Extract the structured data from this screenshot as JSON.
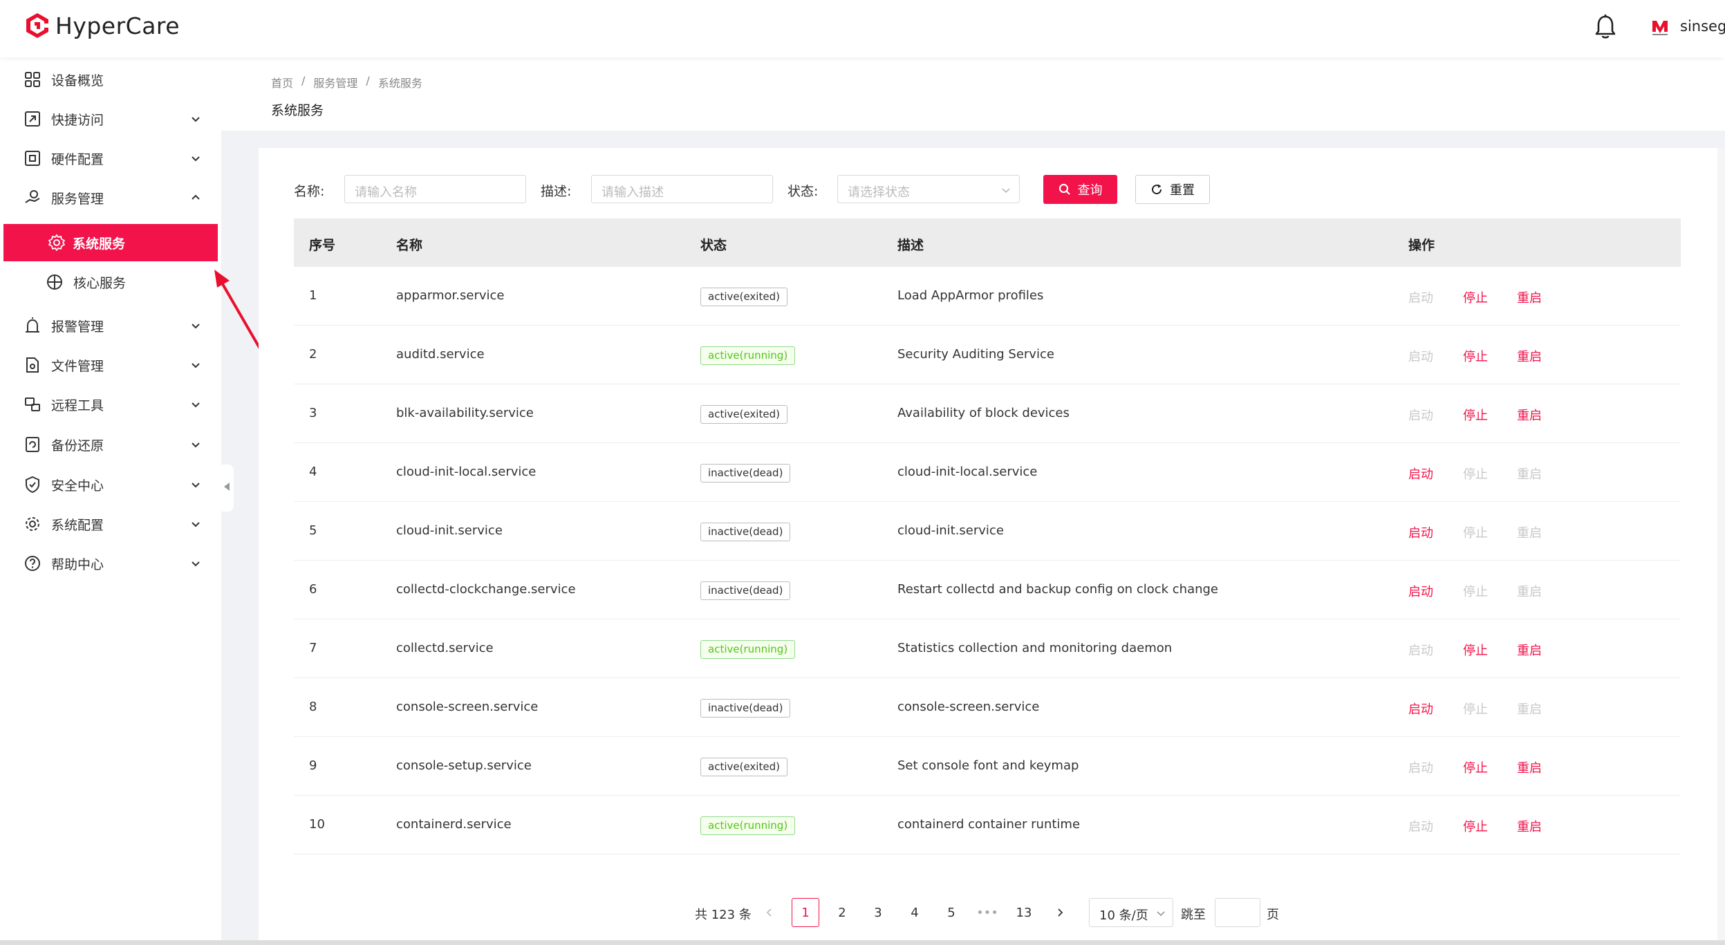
{
  "app": {
    "name": "HyperCare",
    "user": "sinsegye"
  },
  "sidebar": {
    "items": [
      {
        "label": "设备概览"
      },
      {
        "label": "快捷访问"
      },
      {
        "label": "硬件配置"
      },
      {
        "label": "服务管理"
      },
      {
        "label": "系统服务"
      },
      {
        "label": "核心服务"
      },
      {
        "label": "报警管理"
      },
      {
        "label": "文件管理"
      },
      {
        "label": "远程工具"
      },
      {
        "label": "备份还原"
      },
      {
        "label": "安全中心"
      },
      {
        "label": "系统配置"
      },
      {
        "label": "帮助中心"
      }
    ]
  },
  "breadcrumb": [
    "首页",
    "/",
    "服务管理",
    "/",
    "系统服务"
  ],
  "page_title": "系统服务",
  "filters": {
    "name_label": "名称:",
    "name_placeholder": "请输入名称",
    "desc_label": "描述:",
    "desc_placeholder": "请输入描述",
    "status_label": "状态:",
    "status_placeholder": "请选择状态",
    "query_button": "查询",
    "reset_button": "重置"
  },
  "table": {
    "headers": [
      "序号",
      "名称",
      "状态",
      "描述",
      "操作"
    ],
    "actions": [
      "启动",
      "停止",
      "重启"
    ],
    "rows": [
      {
        "no": "1",
        "name": "apparmor.service",
        "status": "active(exited)",
        "desc": "Load AppArmor profiles"
      },
      {
        "no": "2",
        "name": "auditd.service",
        "status": "active(running)",
        "desc": "Security Auditing Service"
      },
      {
        "no": "3",
        "name": "blk-availability.service",
        "status": "active(exited)",
        "desc": "Availability of block devices"
      },
      {
        "no": "4",
        "name": "cloud-init-local.service",
        "status": "inactive(dead)",
        "desc": "cloud-init-local.service"
      },
      {
        "no": "5",
        "name": "cloud-init.service",
        "status": "inactive(dead)",
        "desc": "cloud-init.service"
      },
      {
        "no": "6",
        "name": "collectd-clockchange.service",
        "status": "inactive(dead)",
        "desc": "Restart collectd and backup config on clock change"
      },
      {
        "no": "7",
        "name": "collectd.service",
        "status": "active(running)",
        "desc": "Statistics collection and monitoring daemon"
      },
      {
        "no": "8",
        "name": "console-screen.service",
        "status": "inactive(dead)",
        "desc": "console-screen.service"
      },
      {
        "no": "9",
        "name": "console-setup.service",
        "status": "active(exited)",
        "desc": "Set console font and keymap"
      },
      {
        "no": "10",
        "name": "containerd.service",
        "status": "active(running)",
        "desc": "containerd container runtime"
      }
    ]
  },
  "pagination": {
    "total": "共 123 条",
    "pages": [
      "1",
      "2",
      "3",
      "4",
      "5",
      "•••",
      "13"
    ],
    "current": "1",
    "page_size": "10 条/页",
    "jump_label": "跳至",
    "page_suffix": "页"
  },
  "colors": {
    "accent": "#f2134b",
    "running": "#52c41a"
  }
}
